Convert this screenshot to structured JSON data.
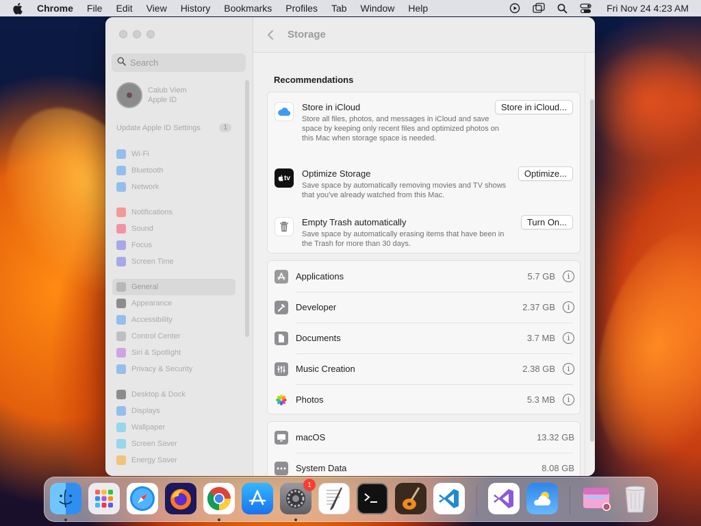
{
  "menubar": {
    "app_name": "Chrome",
    "items": [
      "File",
      "Edit",
      "View",
      "History",
      "Bookmarks",
      "Profiles",
      "Tab",
      "Window",
      "Help"
    ],
    "clock": "Fri Nov 24  4:23 AM"
  },
  "sidebar": {
    "search_placeholder": "Search",
    "profile_name": "Calub Viem",
    "profile_sub": "Apple ID",
    "update_label": "Update Apple ID Settings",
    "update_count": "1",
    "groups": [
      [
        {
          "label": "Wi-Fi",
          "color": "#2f8cf0"
        },
        {
          "label": "Bluetooth",
          "color": "#2f8cf0"
        },
        {
          "label": "Network",
          "color": "#2f8cf0"
        }
      ],
      [
        {
          "label": "Notifications",
          "color": "#ff3b30"
        },
        {
          "label": "Sound",
          "color": "#ff2d55"
        },
        {
          "label": "Focus",
          "color": "#5e5ce6"
        },
        {
          "label": "Screen Time",
          "color": "#5e5ce6"
        }
      ],
      [
        {
          "label": "General",
          "color": "#8e8e93",
          "selected": true
        },
        {
          "label": "Appearance",
          "color": "#1d1d1f"
        },
        {
          "label": "Accessibility",
          "color": "#2f8cf0"
        },
        {
          "label": "Control Center",
          "color": "#8e8e93"
        },
        {
          "label": "Siri & Spotlight",
          "color": "#af52de"
        },
        {
          "label": "Privacy & Security",
          "color": "#2f8cf0"
        }
      ],
      [
        {
          "label": "Desktop & Dock",
          "color": "#1d1d1f"
        },
        {
          "label": "Displays",
          "color": "#2f8cf0"
        },
        {
          "label": "Wallpaper",
          "color": "#34c3f0"
        },
        {
          "label": "Screen Saver",
          "color": "#34c3f0"
        },
        {
          "label": "Energy Saver",
          "color": "#ff9500"
        }
      ]
    ]
  },
  "main": {
    "title": "Storage",
    "section_title": "Recommendations",
    "recommendations": [
      {
        "title": "Store in iCloud",
        "desc": "Store all files, photos, and messages in iCloud and save space by keeping only recent files and optimized photos on this Mac when storage space is needed.",
        "button": "Store in iCloud...",
        "icon": "icloud-icon"
      },
      {
        "title": "Optimize Storage",
        "desc": "Save space by automatically removing movies and TV shows that you've already watched from this Mac.",
        "button": "Optimize...",
        "icon": "apple-tv-icon",
        "icon_text": "tv"
      },
      {
        "title": "Empty Trash automatically",
        "desc": "Save space by automatically erasing items that have been in the Trash for more than 30 days.",
        "button": "Turn On...",
        "icon": "trash-icon"
      }
    ],
    "categories": [
      {
        "label": "Applications",
        "size": "5.7 GB",
        "icon": "app-store-icon"
      },
      {
        "label": "Developer",
        "size": "2.37 GB",
        "icon": "hammer-icon"
      },
      {
        "label": "Documents",
        "size": "3.7 MB",
        "icon": "document-icon"
      },
      {
        "label": "Music Creation",
        "size": "2.38 GB",
        "icon": "music-creation-icon"
      },
      {
        "label": "Photos",
        "size": "5.3 MB",
        "icon": "photos-icon"
      }
    ],
    "system": [
      {
        "label": "macOS",
        "size": "13.32 GB",
        "icon": "display-icon"
      },
      {
        "label": "System Data",
        "size": "8.08 GB",
        "icon": "ellipsis-icon"
      }
    ]
  },
  "dock": {
    "apps": [
      "Finder",
      "Launchpad",
      "Safari",
      "Firefox",
      "Chrome",
      "App Store",
      "System Settings",
      "TextEdit",
      "Terminal",
      "GarageBand",
      "Visual Studio Code",
      "Visual Studio",
      "Weather",
      "Chrome Apps",
      "Trash"
    ],
    "settings_badge": "1"
  }
}
